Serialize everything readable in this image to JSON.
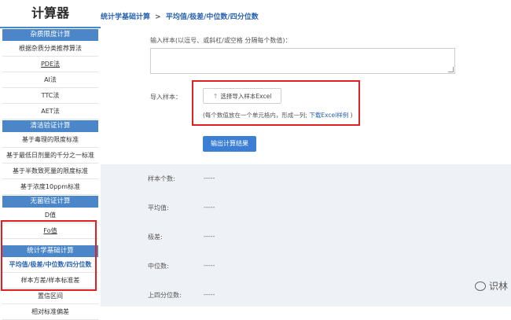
{
  "sidebar": {
    "title": "计算器",
    "sections": [
      {
        "header": "杂质限度计算",
        "items": [
          {
            "label": "根据杂质分类推荐算法"
          },
          {
            "label": "PDE法"
          },
          {
            "label": "AI法"
          },
          {
            "label": "TTC法"
          },
          {
            "label": "AET法"
          }
        ]
      },
      {
        "header": "清洁验证计算",
        "items": [
          {
            "label": "基于毒理的限度标准"
          },
          {
            "label": "基于最低日剂量的千分之一标准"
          },
          {
            "label": "基于半数致死量的限度标准"
          },
          {
            "label": "基于浓度10ppm标准"
          }
        ]
      },
      {
        "header": "无菌验证计算",
        "items": [
          {
            "label": "D值"
          },
          {
            "label": "Fo值"
          }
        ]
      },
      {
        "header": "统计学基础计算",
        "items": [
          {
            "label": "平均值/极差/中位数/四分位数"
          },
          {
            "label": "样本方差/样本标准差"
          },
          {
            "label": "置信区间"
          },
          {
            "label": "相对标准偏差"
          }
        ]
      }
    ]
  },
  "breadcrumb": {
    "parent": "统计学基础计算",
    "separator": ">",
    "current": "平均值/极差/中位数/四分位数"
  },
  "form": {
    "input_label": "输入样本(以逗号、或斜杠/或空格 分隔每个数值)：",
    "textarea_value": "",
    "import_label": "导入样本：",
    "import_button": "选择导入样本Excel",
    "note_prefix": "(每个数值放在一个单元格内，形成一列;",
    "note_link": "下载Excel样例",
    "note_suffix": ")",
    "submit_button": "输出计算结果"
  },
  "results": {
    "rows": [
      {
        "label": "样本个数:",
        "value": "-----"
      },
      {
        "label": "平均值:",
        "value": "-----"
      },
      {
        "label": "极差:",
        "value": "-----"
      },
      {
        "label": "中位数:",
        "value": "-----"
      },
      {
        "label": "上四分位数:",
        "value": "-----"
      }
    ]
  },
  "watermark": "识林",
  "colors": {
    "accent": "#4a86c8",
    "link": "#2a62b0",
    "primary_button": "#3b7fd4",
    "highlight_border": "#e02020",
    "results_bg": "#eef1f6"
  }
}
